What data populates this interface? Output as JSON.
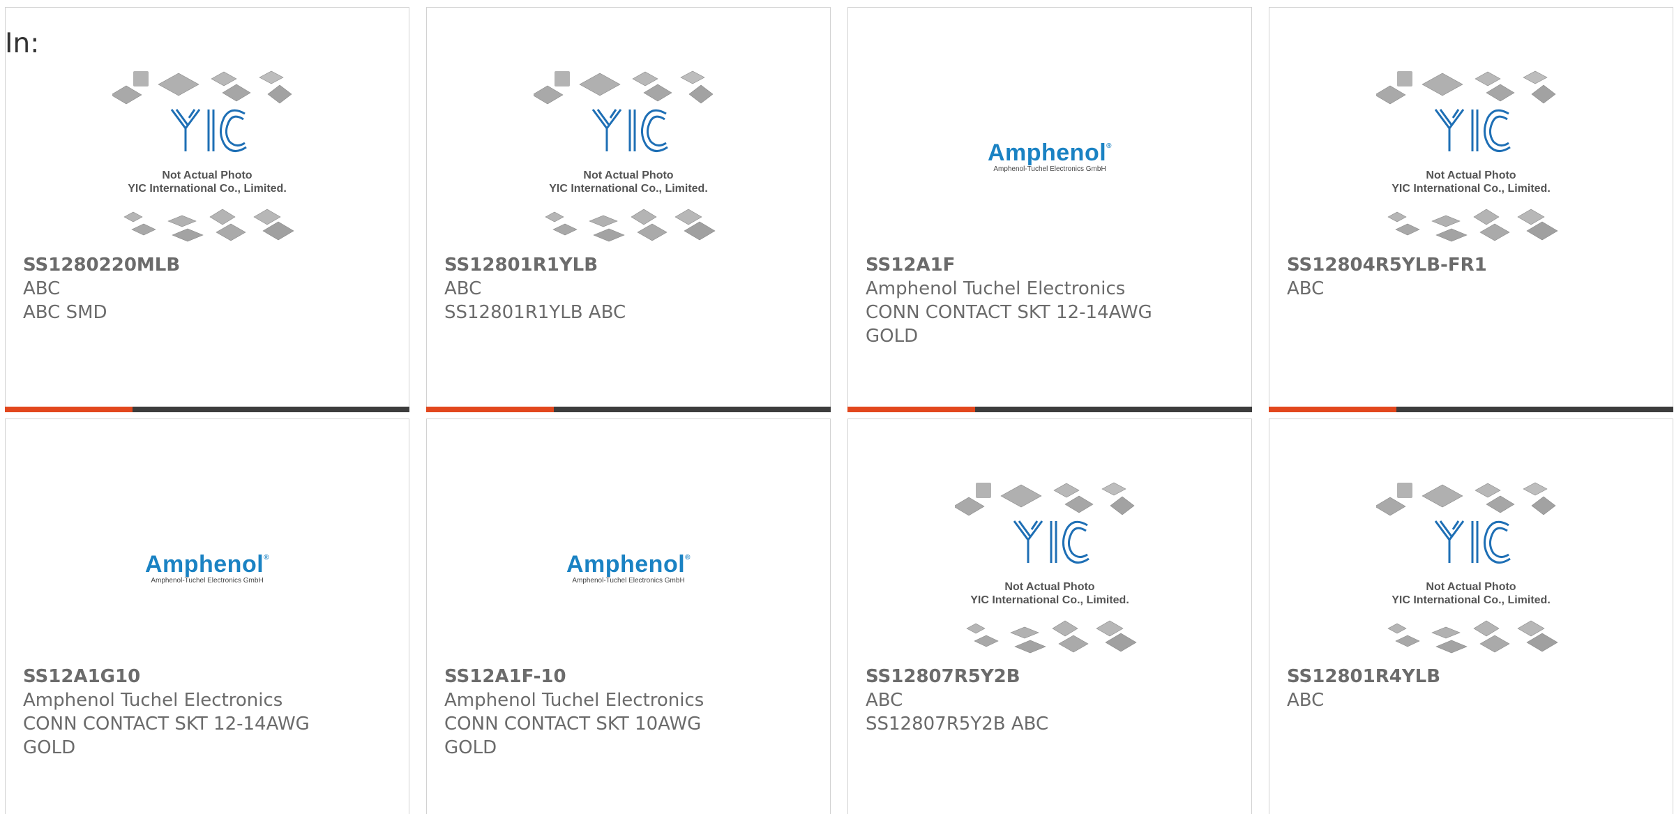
{
  "header": {
    "label": "In:"
  },
  "logos": {
    "yic": {
      "mark": "YIC",
      "caption_line1": "Not Actual Photo",
      "caption_line2": "YIC International Co., Limited."
    },
    "amphenol": {
      "word": "Amphenol",
      "sub": "Amphenol-Tuchel Electronics GmbH"
    }
  },
  "colors": {
    "accent": "#e2471d",
    "bar": "#3c3c3c",
    "text": "#6b6b6b",
    "amphenol_blue": "#1a82c3"
  },
  "products": [
    {
      "part": "SS1280220MLB",
      "manufacturer": "ABC",
      "desc1": "ABC SMD",
      "desc2": "",
      "logo": "yic"
    },
    {
      "part": "SS12801R1YLB",
      "manufacturer": "ABC",
      "desc1": "SS12801R1YLB ABC",
      "desc2": "",
      "logo": "yic"
    },
    {
      "part": "SS12A1F",
      "manufacturer": "Amphenol Tuchel Electronics",
      "desc1": "CONN CONTACT SKT 12-14AWG",
      "desc2": "GOLD",
      "logo": "amphenol"
    },
    {
      "part": "SS12804R5YLB-FR1",
      "manufacturer": "ABC",
      "desc1": "",
      "desc2": "",
      "logo": "yic"
    },
    {
      "part": "SS12A1G10",
      "manufacturer": "Amphenol Tuchel Electronics",
      "desc1": "CONN CONTACT SKT 12-14AWG",
      "desc2": "GOLD",
      "logo": "amphenol"
    },
    {
      "part": "SS12A1F-10",
      "manufacturer": "Amphenol Tuchel Electronics",
      "desc1": "CONN CONTACT SKT 10AWG",
      "desc2": "GOLD",
      "logo": "amphenol"
    },
    {
      "part": "SS12807R5Y2B",
      "manufacturer": "ABC",
      "desc1": "SS12807R5Y2B ABC",
      "desc2": "",
      "logo": "yic"
    },
    {
      "part": "SS12801R4YLB",
      "manufacturer": "ABC",
      "desc1": "",
      "desc2": "",
      "logo": "yic"
    }
  ]
}
